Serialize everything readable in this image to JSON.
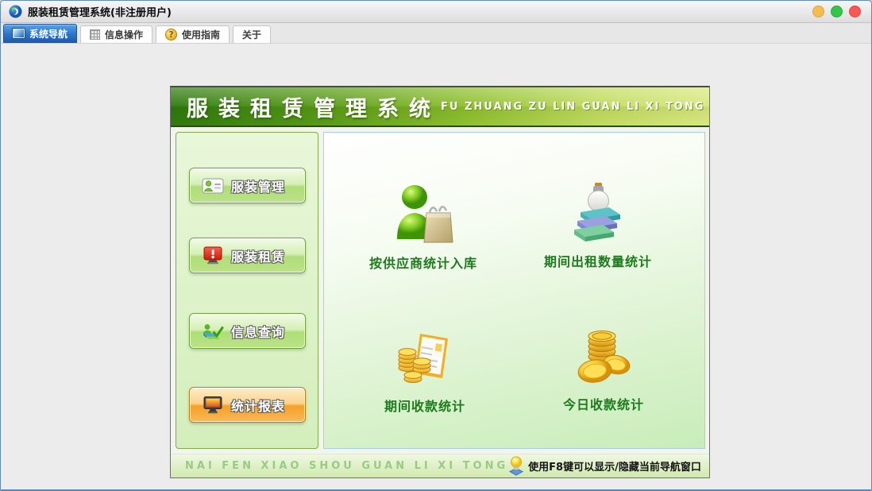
{
  "window": {
    "title": "服装租赁管理系统(非注册用户)"
  },
  "tabs": [
    {
      "label": "系统导航",
      "icon": "monitor-icon",
      "selected": true
    },
    {
      "label": "信息操作",
      "icon": "grid-icon",
      "selected": false
    },
    {
      "label": "使用指南",
      "icon": "help-coin-icon",
      "selected": false
    },
    {
      "label": "关于",
      "icon": "",
      "selected": false
    }
  ],
  "help_coin_glyph": "?",
  "panel": {
    "header": {
      "title": "服装租赁管理系统",
      "subtitle": "FU ZHUANG ZU LIN GUAN LI XI TONG"
    },
    "sidebar": [
      {
        "label": "服装管理",
        "icon": "member-card-icon",
        "style": "green"
      },
      {
        "label": "服装租赁",
        "icon": "monitor-alert-icon",
        "style": "green"
      },
      {
        "label": "信息查询",
        "icon": "books-check-icon",
        "style": "green"
      },
      {
        "label": "统计报表",
        "icon": "report-monitor-icon",
        "style": "orange"
      }
    ],
    "shortcuts": [
      {
        "label": "按供应商统计入库",
        "icon": "supplier-bag-icon"
      },
      {
        "label": "期间出租数量统计",
        "icon": "books-bulb-icon"
      },
      {
        "label": "期间收款统计",
        "icon": "coins-document-icon"
      },
      {
        "label": "今日收款统计",
        "icon": "gold-coins-icon"
      }
    ],
    "footer": {
      "watermark": "NAI FEN XIAO SHOU GUAN LI XI TONG",
      "hint": "使用F8键可以显示/隐藏当前导航窗口"
    }
  },
  "colors": {
    "header_green_dark": "#2f7a0e",
    "header_green_light": "#d9e87f",
    "selected_tab_blue": "#2b74ca",
    "accent_orange": "#f6a02a",
    "shortcut_label_green": "#1d7a1d"
  }
}
